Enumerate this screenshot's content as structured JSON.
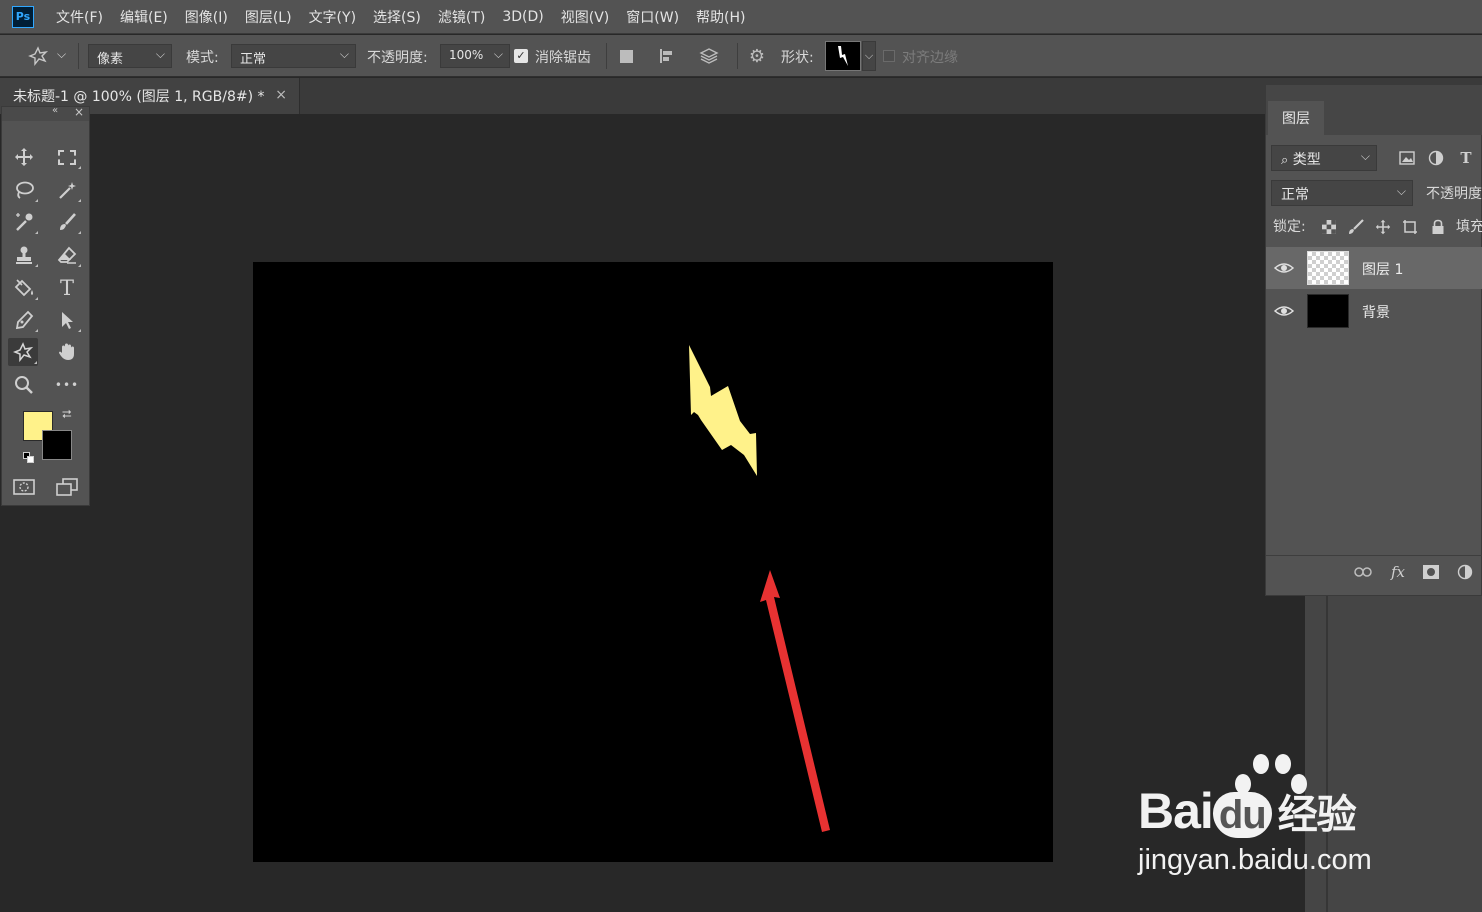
{
  "app": {
    "logo": "Ps"
  },
  "menu": [
    "文件(F)",
    "编辑(E)",
    "图像(I)",
    "图层(L)",
    "文字(Y)",
    "选择(S)",
    "滤镜(T)",
    "3D(D)",
    "视图(V)",
    "窗口(W)",
    "帮助(H)"
  ],
  "options": {
    "tool_icon": "custom-shape-icon",
    "fill_type": "像素",
    "mode_label": "模式:",
    "mode_value": "正常",
    "opacity_label": "不透明度:",
    "opacity_value": "100%",
    "antialias_label": "消除锯齿",
    "antialias_checked": true,
    "shape_label": "形状:",
    "align_edges_label": "对齐边缘"
  },
  "document": {
    "tab_title": "未标题-1 @ 100% (图层 1, RGB/8#) *",
    "close": "×"
  },
  "toolbox": {
    "tools": [
      "move-icon",
      "marquee-icon",
      "lasso-icon",
      "magic-wand-icon",
      "eyedropper-icon",
      "brush-icon",
      "stamp-icon",
      "eraser-icon",
      "paint-bucket-icon",
      "type-icon",
      "pen-icon",
      "path-select-icon",
      "custom-shape-icon",
      "hand-icon",
      "zoom-icon",
      "more-icon"
    ],
    "active_tool": "custom-shape-icon",
    "type_glyph": "T",
    "more_glyph": "•••",
    "fg_color": "#fff28a",
    "bg_color": "#000000"
  },
  "layers_panel": {
    "tab": "图层",
    "filter_value": "类型",
    "blend_mode": "正常",
    "opacity_label": "不透明度",
    "lock_label": "锁定:",
    "fill_label": "填充",
    "type_glyph": "T",
    "fx_label": "fx",
    "layers": [
      {
        "name": "图层 1",
        "visible": true,
        "selected": true,
        "thumb": "transparent"
      },
      {
        "name": "背景",
        "visible": true,
        "selected": false,
        "thumb": "#000000"
      }
    ]
  },
  "canvas": {
    "background": "#000000",
    "shape_color": "#fff28a",
    "arrow_color": "#e83232"
  },
  "colors": {
    "menubar": "#535353",
    "workspace": "#282828",
    "panel": "#535353"
  },
  "watermark": {
    "brand_latin": "Bai",
    "brand_du": "du",
    "brand_cn": "经验",
    "url": "jingyan.baidu.com"
  }
}
